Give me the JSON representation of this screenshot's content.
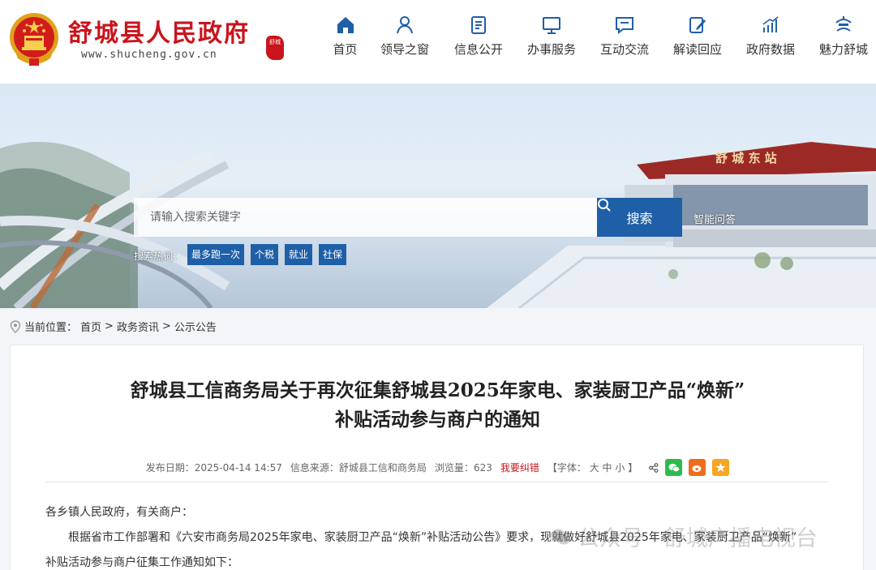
{
  "header": {
    "title": "舒城县人民政府",
    "domain": "www.shucheng.gov.cn",
    "seal_text": "舒城"
  },
  "nav": [
    {
      "label": "首页",
      "icon": "home-icon"
    },
    {
      "label": "领导之窗",
      "icon": "person-icon"
    },
    {
      "label": "信息公开",
      "icon": "document-icon"
    },
    {
      "label": "办事服务",
      "icon": "monitor-icon"
    },
    {
      "label": "互动交流",
      "icon": "chat-icon"
    },
    {
      "label": "解读回应",
      "icon": "edit-icon"
    },
    {
      "label": "政府数据",
      "icon": "chart-icon"
    },
    {
      "label": "魅力舒城",
      "icon": "landmark-icon"
    }
  ],
  "search": {
    "placeholder": "请输入搜索关键字",
    "button_label": "搜索",
    "smart_qa": "智能问答",
    "hot_label": "搜索热词：",
    "hot_tags": [
      "最多跑一次",
      "个税",
      "就业",
      "社保"
    ]
  },
  "banner": {
    "station_sign": "舒 城 东 站"
  },
  "breadcrumb": {
    "prefix": "当前位置：",
    "items": [
      "首页",
      "政务资讯",
      "公示公告"
    ],
    "separator": ">"
  },
  "article": {
    "title_line1": "舒城县工信商务局关于再次征集舒城县2025年家电、家装厨卫产品“焕新”",
    "title_line2": "补贴活动参与商户的通知",
    "publish_label": "发布日期：",
    "publish_date": "2025-04-14 14:57",
    "source_label": "信息来源：",
    "source": "舒城县工信和商务局",
    "views_label": "浏览量：",
    "views": "623",
    "report_error": "我要纠错",
    "font_label": "【字体：",
    "font_sizes": [
      "大",
      "中",
      "小"
    ],
    "font_close": "】",
    "para1": "各乡镇人民政府，有关商户：",
    "para2": "根据省市工作部署和《六安市商务局2025年家电、家装厨卫产品“焕新”补贴活动公告》要求，现就做好舒城县2025年家电、家装厨卫产品“焕新”",
    "para3": "补贴活动参与商户征集工作通知如下："
  },
  "watermark": "公众号 · 舒城广播电视台",
  "colors": {
    "brand_red": "#c9141c",
    "nav_blue": "#1f5fa8",
    "wechat_green": "#2dbb4f",
    "weibo_orange": "#f06d1b",
    "qzone_yellow": "#f5a623"
  }
}
